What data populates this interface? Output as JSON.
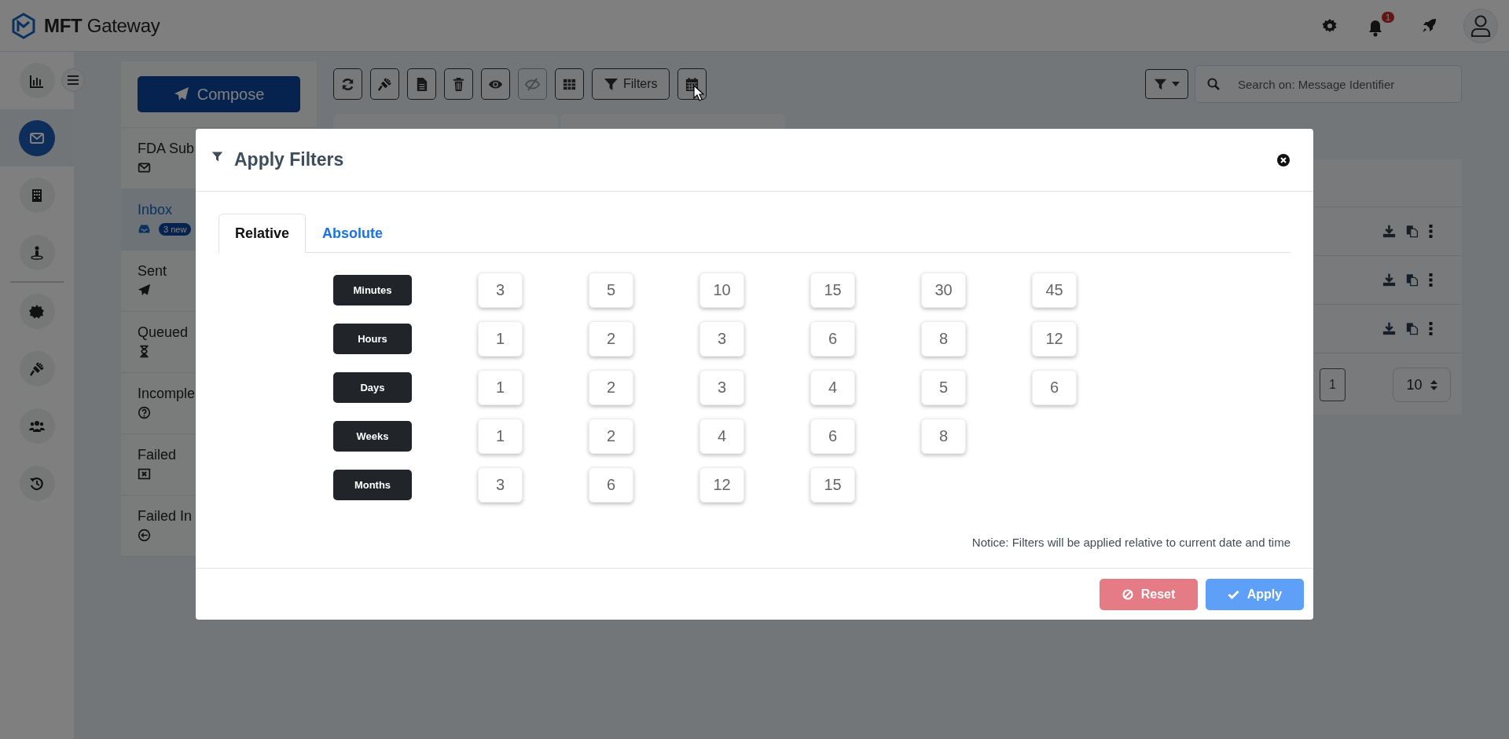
{
  "header": {
    "brand_bold": "MFT",
    "brand": "Gateway",
    "notification_count": "1"
  },
  "rail": [
    {
      "kind": "chart",
      "selected": false
    },
    {
      "kind": "envelope",
      "selected": true
    },
    {
      "kind": "building",
      "selected": false
    },
    {
      "kind": "person-pin",
      "selected": false
    },
    {
      "kind": "badge",
      "selected": false
    },
    {
      "kind": "plug",
      "selected": false
    },
    {
      "kind": "users",
      "selected": false
    },
    {
      "kind": "history",
      "selected": false
    }
  ],
  "folders": {
    "compose": "Compose",
    "items": [
      {
        "label": "FDA Sub",
        "kind": "envelope",
        "selected": false
      },
      {
        "label": "Inbox",
        "kind": "inbox",
        "selected": true,
        "badge": "3 new"
      },
      {
        "label": "Sent",
        "kind": "plane",
        "selected": false
      },
      {
        "label": "Queued",
        "kind": "hourglass",
        "selected": false
      },
      {
        "label": "Incomple",
        "kind": "question",
        "selected": false
      },
      {
        "label": "Failed",
        "kind": "xbox",
        "selected": false
      },
      {
        "label": "Failed In",
        "kind": "circle-arrow",
        "selected": false
      }
    ]
  },
  "toolbar": {
    "buttons": [
      {
        "kind": "refresh",
        "disabled": false
      },
      {
        "kind": "plug",
        "disabled": false
      },
      {
        "kind": "file",
        "disabled": false
      },
      {
        "kind": "trash",
        "disabled": false
      },
      {
        "kind": "eye",
        "disabled": false
      },
      {
        "kind": "eye-slash",
        "disabled": true
      },
      {
        "kind": "table",
        "disabled": false
      },
      {
        "kind": "filter",
        "disabled": false,
        "label": "Filters"
      },
      {
        "kind": "calendar",
        "disabled": false
      }
    ],
    "search": {
      "placeholder": "Search on: Message Identifier"
    }
  },
  "pagination": {
    "page": "1",
    "page_size": "10"
  },
  "modal": {
    "title": "Apply Filters",
    "tabs": [
      {
        "label": "Relative",
        "selected": true
      },
      {
        "label": "Absolute",
        "selected": false
      }
    ],
    "groups": [
      {
        "unit": "Minutes",
        "values": [
          "3",
          "5",
          "10",
          "15",
          "30",
          "45"
        ]
      },
      {
        "unit": "Hours",
        "values": [
          "1",
          "2",
          "3",
          "6",
          "8",
          "12"
        ]
      },
      {
        "unit": "Days",
        "values": [
          "1",
          "2",
          "3",
          "4",
          "5",
          "6"
        ]
      },
      {
        "unit": "Weeks",
        "values": [
          "1",
          "2",
          "4",
          "6",
          "8"
        ]
      },
      {
        "unit": "Months",
        "values": [
          "3",
          "6",
          "12",
          "15"
        ]
      }
    ],
    "notice": "Notice: Filters will be applied relative to current date and time",
    "buttons": [
      {
        "kind": "reset",
        "label": "Reset"
      },
      {
        "kind": "apply",
        "label": "Apply"
      }
    ]
  }
}
